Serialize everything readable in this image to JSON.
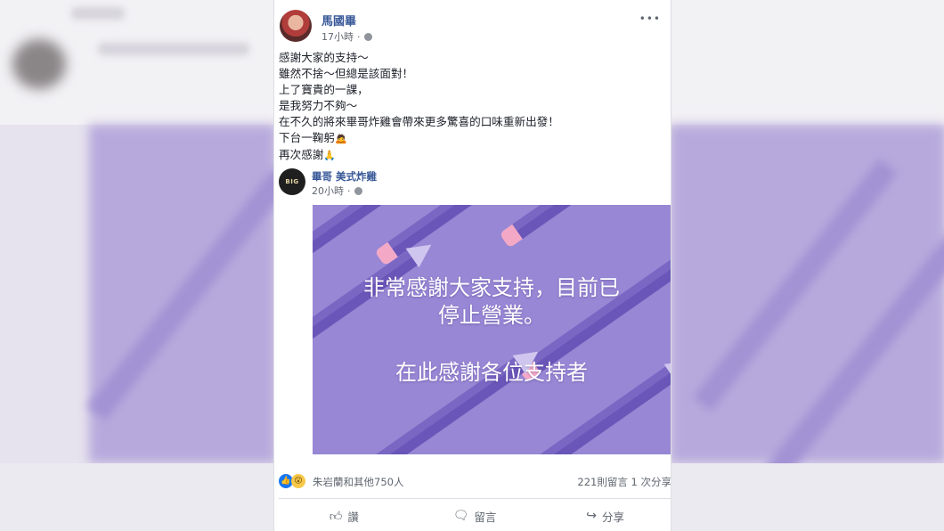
{
  "post": {
    "author": "馬國畢",
    "time": "17小時",
    "lines": [
      "感謝大家的支持～",
      "雖然不捨～但總是該面對！",
      "上了寶貴的一課，",
      "是我努力不夠～",
      "在不久的將來畢哥炸雞會帶來更多驚喜的口味重新出發！",
      "下台一鞠躬",
      "再次感謝"
    ],
    "emoji_bow": "🙇",
    "emoji_pray": "🙏"
  },
  "shared": {
    "page_name": "畢哥 美式炸雞",
    "time": "20小時",
    "avatar_text": "BIG",
    "image_line1": "非常感謝大家支持，目前已",
    "image_line2": "停止營業。",
    "image_line3": "在此感謝各位支持者"
  },
  "engagement": {
    "reactions_text": "朱岩蘭和其他750人",
    "stats_text": "221則留言 1 次分享"
  },
  "actions": {
    "like": "讚",
    "comment": "留言",
    "share": "分享"
  },
  "icons": {
    "more": "more-icon",
    "globe": "globe-icon",
    "like": "thumbs-up-icon",
    "comment": "comment-icon",
    "share": "share-icon"
  },
  "colors": {
    "link": "#385898",
    "image_bg": "#9787d4",
    "like_blue": "#1877f2"
  }
}
